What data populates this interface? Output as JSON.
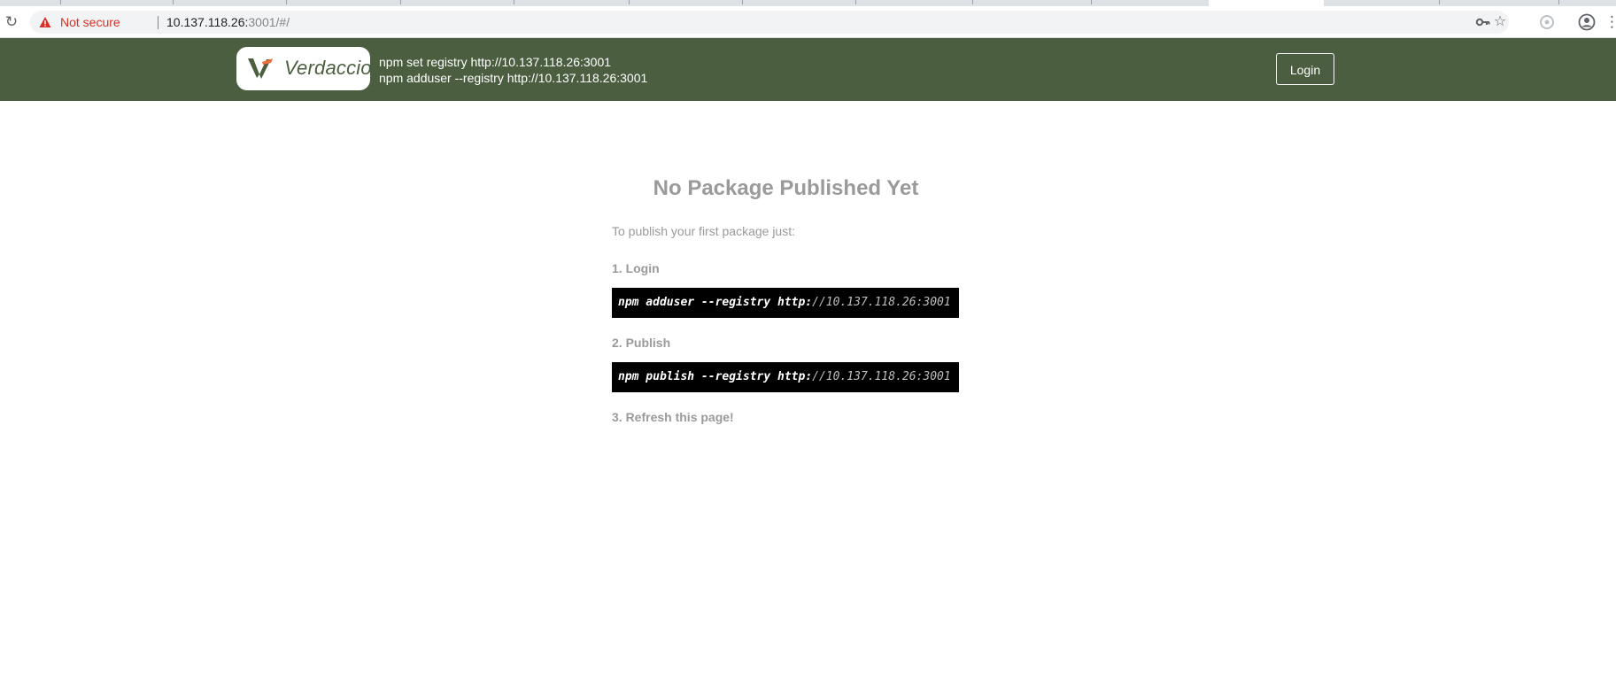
{
  "browser": {
    "security_label": "Not secure",
    "url_host": "10.137.118.26:",
    "url_rest": "3001/#/",
    "icons": [
      "reload-icon",
      "warning-icon",
      "key-icon",
      "star-icon",
      "extension-icon",
      "profile-icon",
      "menu-icon"
    ]
  },
  "header": {
    "logo_text": "Verdaccio",
    "cmd_set_registry": "npm set registry http://10.137.118.26:3001",
    "cmd_adduser": "npm adduser --registry http://10.137.118.26:3001",
    "login_label": "Login",
    "colors": {
      "header_bg": "#4b5e40",
      "logo_accent": "#f26b3a"
    }
  },
  "main": {
    "title": "No Package Published Yet",
    "intro": "To publish your first package just:",
    "steps": [
      {
        "label": "1. Login",
        "cmd": "npm adduser --registry ",
        "proto": "http:",
        "addr": "//10.137.118.26:3001"
      },
      {
        "label": "2. Publish",
        "cmd": "npm publish --registry ",
        "proto": "http:",
        "addr": "//10.137.118.26:3001"
      },
      {
        "label": "3. Refresh this page!"
      }
    ]
  }
}
